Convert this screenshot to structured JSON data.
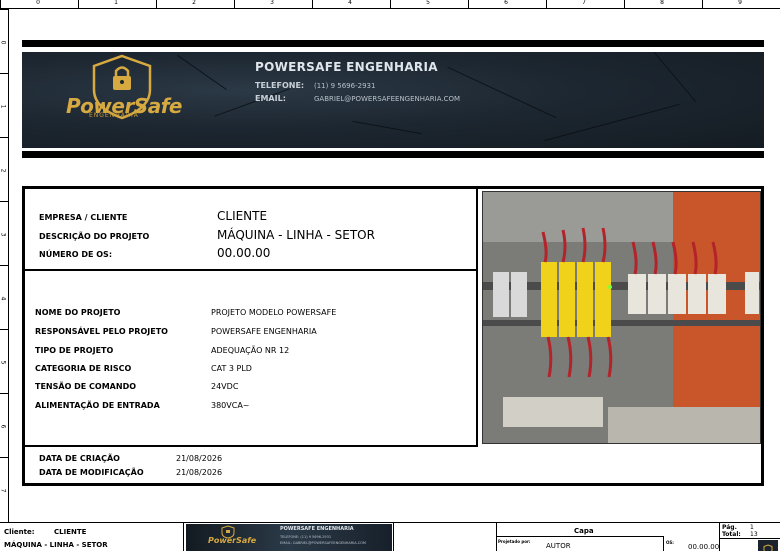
{
  "ruler": {
    "columns": [
      "0",
      "1",
      "2",
      "3",
      "4",
      "5",
      "6",
      "7",
      "8",
      "9"
    ],
    "rows": [
      "0",
      "1",
      "2",
      "3",
      "4",
      "5",
      "6",
      "7"
    ]
  },
  "header": {
    "logo_text": "PowerSafe",
    "logo_sub": "ENGENHARIA",
    "company_name": "POWERSAFE ENGENHARIA",
    "phone_label": "TELEFONE:",
    "phone_value": "(11) 9 5696-2931",
    "email_label": "EMAIL:",
    "email_value": "GABRIEL@POWERSAFEENGENHARIA.COM"
  },
  "client_block": {
    "company_label": "EMPRESA / CLIENTE",
    "company_value": "CLIENTE",
    "description_label": "DESCRIÇÃO DO PROJETO",
    "description_value": "MÁQUINA - LINHA - SETOR",
    "os_label": "NÚMERO DE OS:",
    "os_value": "00.00.00"
  },
  "project_block": {
    "rows": [
      {
        "label": "NOME DO PROJETO",
        "value": "PROJETO MODELO POWERSAFE"
      },
      {
        "label": "RESPONSÁVEL PELO PROJETO",
        "value": "POWERSAFE ENGENHARIA"
      },
      {
        "label": "TIPO DE PROJETO",
        "value": "ADEQUAÇÃO NR 12"
      },
      {
        "label": "CATEGORIA DE RISCO",
        "value": "CAT 3 PLD"
      },
      {
        "label": "TENSÃO DE COMANDO",
        "value": "24VDC"
      },
      {
        "label": "ALIMENTAÇÃO DE ENTRADA",
        "value": "380VCA~"
      }
    ]
  },
  "dates_block": {
    "created_label": "DATA DE CRIAÇÃO",
    "created_value": "21/08/2026",
    "modified_label": "DATA DE MODIFICAÇÃO",
    "modified_value": "21/08/2026"
  },
  "footer": {
    "client_label": "Cliente:",
    "client_value": "CLIENTE",
    "machine_value": "MÁQUINA - LINHA - SETOR",
    "mini_company": "POWERSAFE ENGENHARIA",
    "mini_phone": "TELEFONE: (11) 9 5696-2931",
    "mini_email": "EMAIL: GABRIEL@POWERSAFEENGENHARIA.COM",
    "mini_logo": "PowerSafe",
    "sheet_title": "Capa",
    "designer_label": "Projetado por:",
    "designer_value": "AUTOR",
    "os_label": "OS:",
    "os_value": "00.00.00",
    "page_label": "Pág.",
    "page_value": "1",
    "total_label": "Total:",
    "total_value": "13"
  },
  "colors": {
    "gold": "#d7a941",
    "banner_dark": "#1d2731",
    "relay_yellow": "#f1d21b",
    "panel_orange": "#d5572a"
  }
}
